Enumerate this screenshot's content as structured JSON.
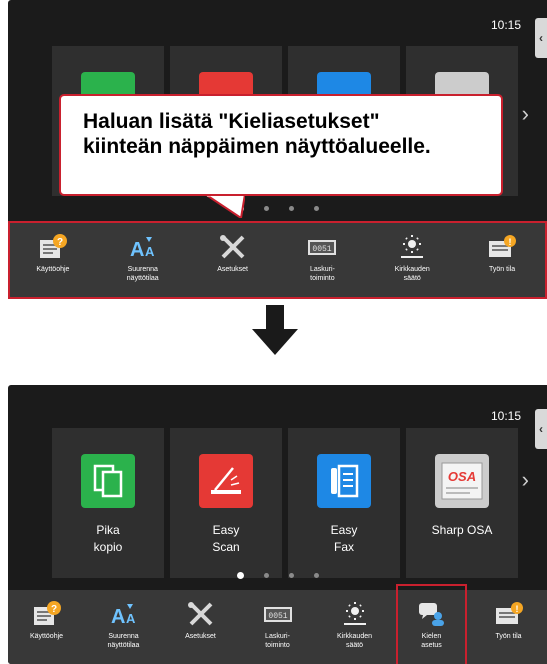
{
  "top_screen": {
    "time": "10:15",
    "callout_text": "Haluan lisätä \"Kieliasetukset\"\nkiinteän näppäimen näyttöalueelle.",
    "dock_items": [
      {
        "label": "Käyttöohje",
        "icon": "help-manual-icon"
      },
      {
        "label": "Suurenna\nnäyttötilaa",
        "icon": "enlarge-display-icon"
      },
      {
        "label": "Asetukset",
        "icon": "settings-tools-icon"
      },
      {
        "label": "Laskuri-\ntoiminto",
        "icon": "counter-icon"
      },
      {
        "label": "Kirkkauden\nsäätö",
        "icon": "brightness-icon"
      },
      {
        "label": "Työn tila",
        "icon": "job-status-icon"
      }
    ]
  },
  "bottom_screen": {
    "time": "10:15",
    "cards": [
      {
        "label": "Pika\nkopio",
        "icon": "quick-copy-icon",
        "color": "#2bb24c"
      },
      {
        "label": "Easy\nScan",
        "icon": "easy-scan-icon",
        "color": "#e53935"
      },
      {
        "label": "Easy\nFax",
        "icon": "easy-fax-icon",
        "color": "#1e88e5"
      },
      {
        "label": "Sharp OSA",
        "icon": "sharp-osa-icon",
        "color": "#cccccc"
      }
    ],
    "dock_items": [
      {
        "label": "Käyttöohje",
        "icon": "help-manual-icon"
      },
      {
        "label": "Suurenna\nnäyttötilaa",
        "icon": "enlarge-display-icon"
      },
      {
        "label": "Asetukset",
        "icon": "settings-tools-icon"
      },
      {
        "label": "Laskuri-\ntoiminto",
        "icon": "counter-icon"
      },
      {
        "label": "Kirkkauden\nsäätö",
        "icon": "brightness-icon"
      },
      {
        "label": "Kielen\nasetus",
        "icon": "language-setting-icon"
      },
      {
        "label": "Työn tila",
        "icon": "job-status-icon"
      }
    ]
  },
  "colors": {
    "highlight": "#c9202e",
    "screen_bg": "#1b1b1b",
    "dock_bg": "#383838"
  }
}
